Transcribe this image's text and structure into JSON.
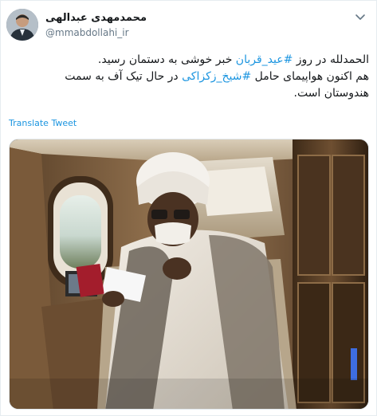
{
  "author": {
    "display_name": "محمدمهدی عبدالهی",
    "handle": "@mmabdollahi_ir"
  },
  "tweet": {
    "line1_pre": "الحمدلله در روز ",
    "hashtag1": "#عید_قربان",
    "line1_post": " خبر خوشی به دستمان رسید.",
    "line2_pre": "هم اکنون هواپیمای حامل ",
    "hashtag2": "#شیخ_زکزاکی",
    "line2_post": " در حال تیک آف به سمت",
    "line3": "هندوستان است."
  },
  "translate_label": "Translate Tweet",
  "colors": {
    "link": "#1b95e0",
    "text": "#14171a",
    "muted": "#657786"
  },
  "icons": {
    "menu": "chevron-down-icon"
  }
}
